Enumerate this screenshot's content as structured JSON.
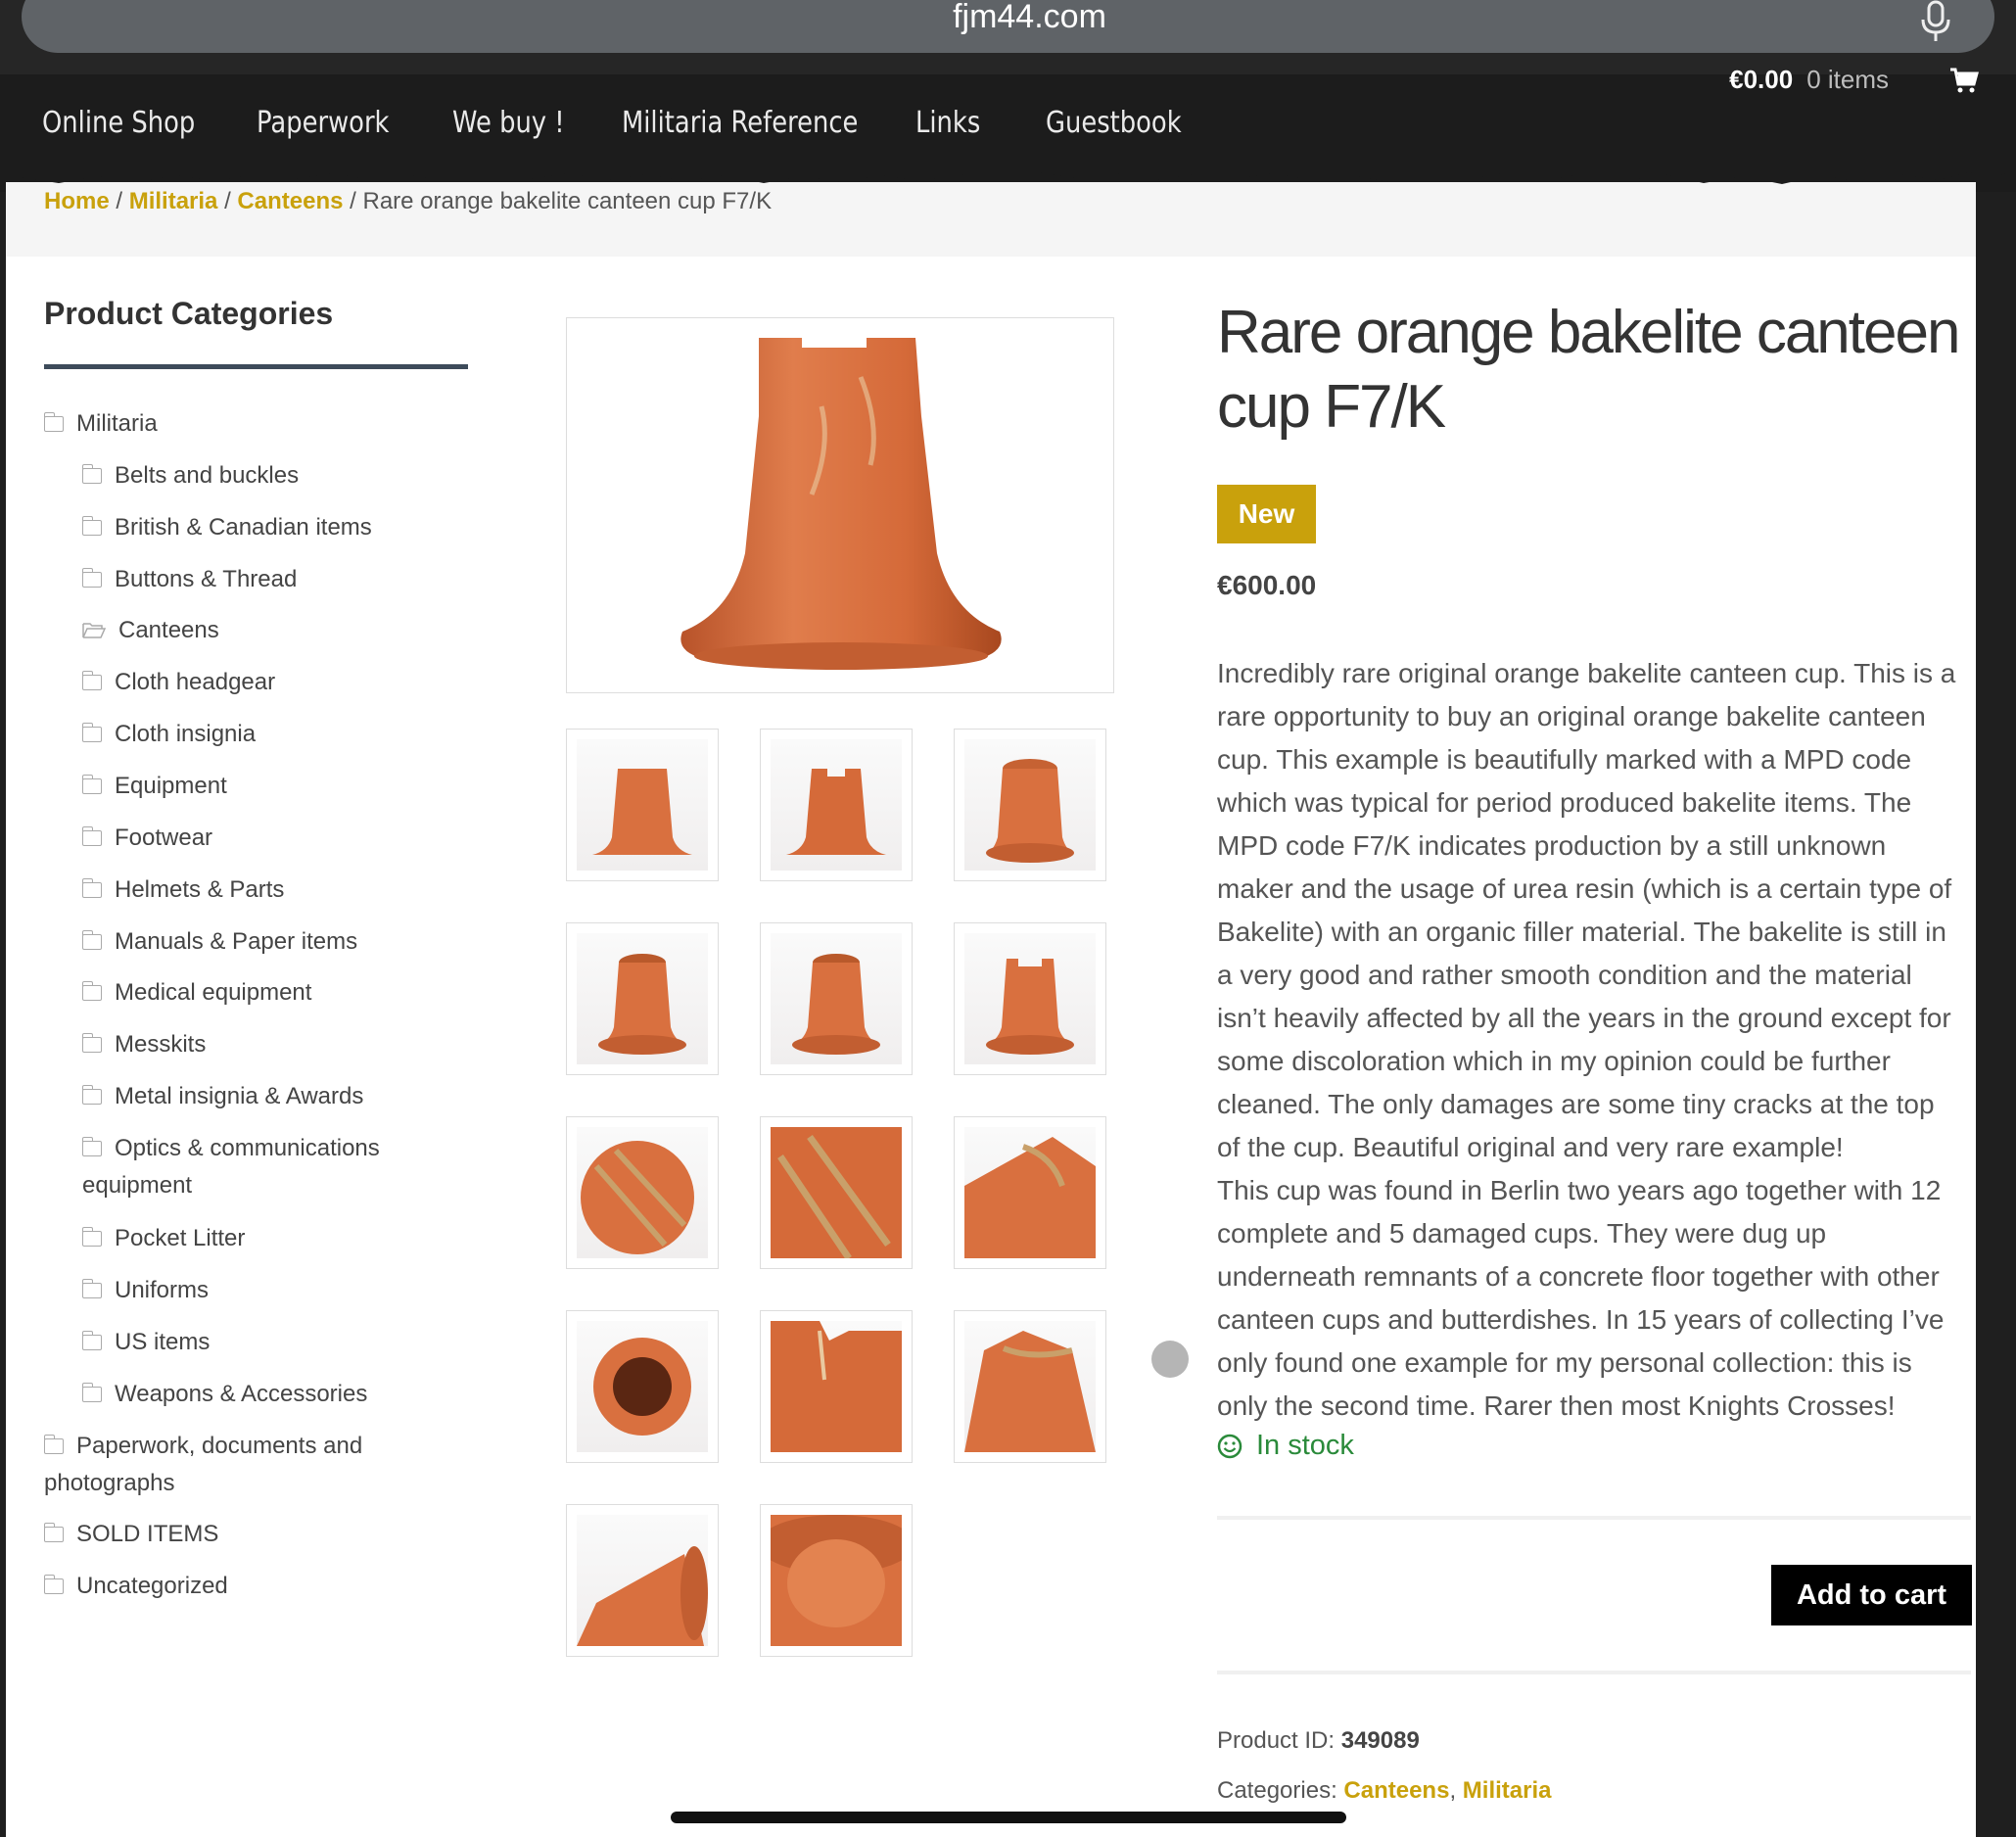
{
  "browser": {
    "url": "fjm44.com"
  },
  "nav": {
    "items": [
      "Online Shop",
      "Paperwork",
      "We buy !",
      "Militaria Reference",
      "Links",
      "Guestbook"
    ],
    "cart_amount": "€0.00",
    "cart_items": "0 items"
  },
  "breadcrumb": {
    "home": "Home",
    "sep": " / ",
    "level1": "Militaria",
    "level2": "Canteens",
    "current": "Rare orange bakelite canteen cup F7/K"
  },
  "sidebar": {
    "title": "Product Categories",
    "categories": [
      "Militaria",
      "Belts and buckles",
      "British & Canadian items",
      "Buttons & Thread",
      "Canteens",
      "Cloth headgear",
      "Cloth insignia",
      "Equipment",
      "Footwear",
      "Helmets & Parts",
      "Manuals & Paper items",
      "Medical equipment",
      "Messkits",
      "Metal insignia & Awards",
      "Optics & communications",
      "equipment",
      "Pocket Litter",
      "Uniforms",
      "US items",
      "Weapons & Accessories",
      "Paperwork, documents and",
      "photographs",
      "SOLD ITEMS",
      "Uncategorized"
    ]
  },
  "product": {
    "title": "Rare orange bakelite canteen cup F7/K",
    "badge": "New",
    "price": "€600.00",
    "description": [
      "Incredibly rare original orange bakelite canteen cup. This is a",
      "rare opportunity to buy an original orange bakelite canteen",
      "cup. This example is beautifully marked with a MPD code",
      "which was typical for period produced bakelite items. The",
      "MPD code F7/K indicates production by a still unknown",
      "maker and the usage of urea resin (which is a certain type of",
      "Bakelite) with an organic filler material. The bakelite is still in",
      "a very good and rather smooth condition and the material",
      "isn’t heavily affected by all the years in the ground except for",
      "some discoloration which in my opinion could be further",
      "cleaned. The only damages are some tiny cracks at the top",
      "of the cup. Beautiful original and very rare example!",
      "This cup was found in Berlin two years ago together with 12",
      "complete and 5 damaged cups. They were dug up",
      "underneath remnants of a concrete floor together with other",
      "canteen cups and butterdishes. In 15 years of collecting I’ve",
      "only found one example for my personal collection: this is",
      "only the second time. Rarer then most Knights Crosses!"
    ],
    "stock": "In stock",
    "add_to_cart": "Add to cart",
    "product_id_label": "Product ID:",
    "product_id": "349089",
    "categories_label": "Categories:",
    "categories": [
      "Canteens",
      "Militaria"
    ],
    "categories_sep": ", "
  },
  "colors": {
    "accent": "#c9a10c",
    "stock": "#2a8a3a",
    "header": "#1c1c1c",
    "cup": "#d9703f"
  }
}
